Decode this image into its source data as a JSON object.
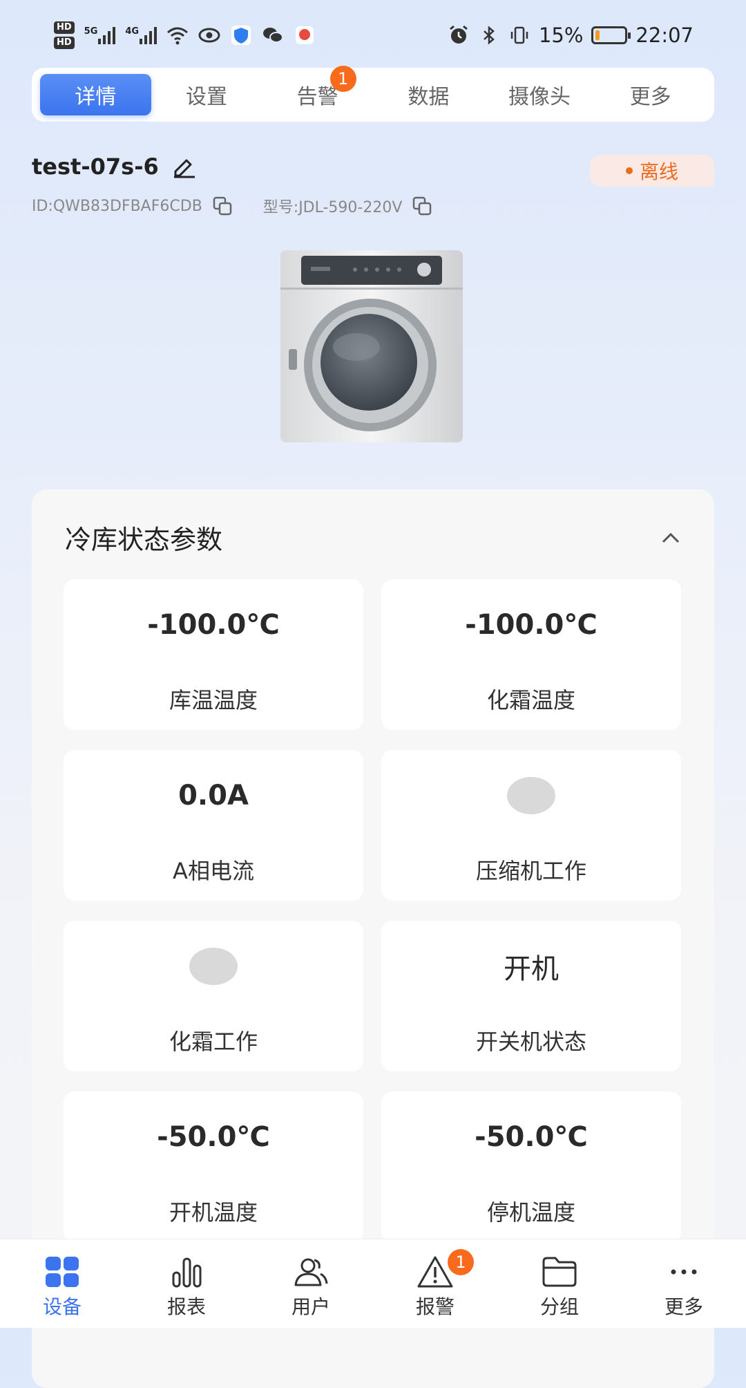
{
  "status_bar": {
    "hd1": "HD",
    "hd2": "HD",
    "sig1_label": "5G",
    "sig2_label": "4G",
    "battery_text": "15%",
    "battery_level": 0.15,
    "time": "22:07"
  },
  "tabs": [
    {
      "label": "详情",
      "active": true
    },
    {
      "label": "设置"
    },
    {
      "label": "告警",
      "badge": "1"
    },
    {
      "label": "数据"
    },
    {
      "label": "摄像头"
    },
    {
      "label": "更多"
    }
  ],
  "device": {
    "name": "test-07s-6",
    "status": "离线",
    "id_text": "ID:QWB83DFBAF6CDB",
    "model_text": "型号:JDL-590-220V"
  },
  "panel": {
    "title": "冷库状态参数",
    "params": [
      {
        "value": "-100.0℃",
        "label": "库温温度"
      },
      {
        "value": "-100.0℃",
        "label": "化霜温度"
      },
      {
        "value": "0.0A",
        "label": "A相电流"
      },
      {
        "value": "",
        "label": "压缩机工作",
        "indicator": true
      },
      {
        "value": "",
        "label": "化霜工作",
        "indicator": true
      },
      {
        "value": "开机",
        "label": "开关机状态"
      },
      {
        "value": "-50.0℃",
        "label": "开机温度"
      },
      {
        "value": "-50.0℃",
        "label": "停机温度"
      }
    ]
  },
  "bottom_nav": [
    {
      "label": "设备",
      "icon": "grid-icon",
      "active": true
    },
    {
      "label": "报表",
      "icon": "bar-chart-icon"
    },
    {
      "label": "用户",
      "icon": "users-icon"
    },
    {
      "label": "报警",
      "icon": "warning-icon",
      "badge": "1"
    },
    {
      "label": "分组",
      "icon": "folder-icon"
    },
    {
      "label": "更多",
      "icon": "more-dots-icon"
    }
  ],
  "colors": {
    "accent": "#3b74ee",
    "badge": "#f86b1c",
    "offline": "#ec6c1f",
    "offline_bg": "#fbe9e5"
  }
}
